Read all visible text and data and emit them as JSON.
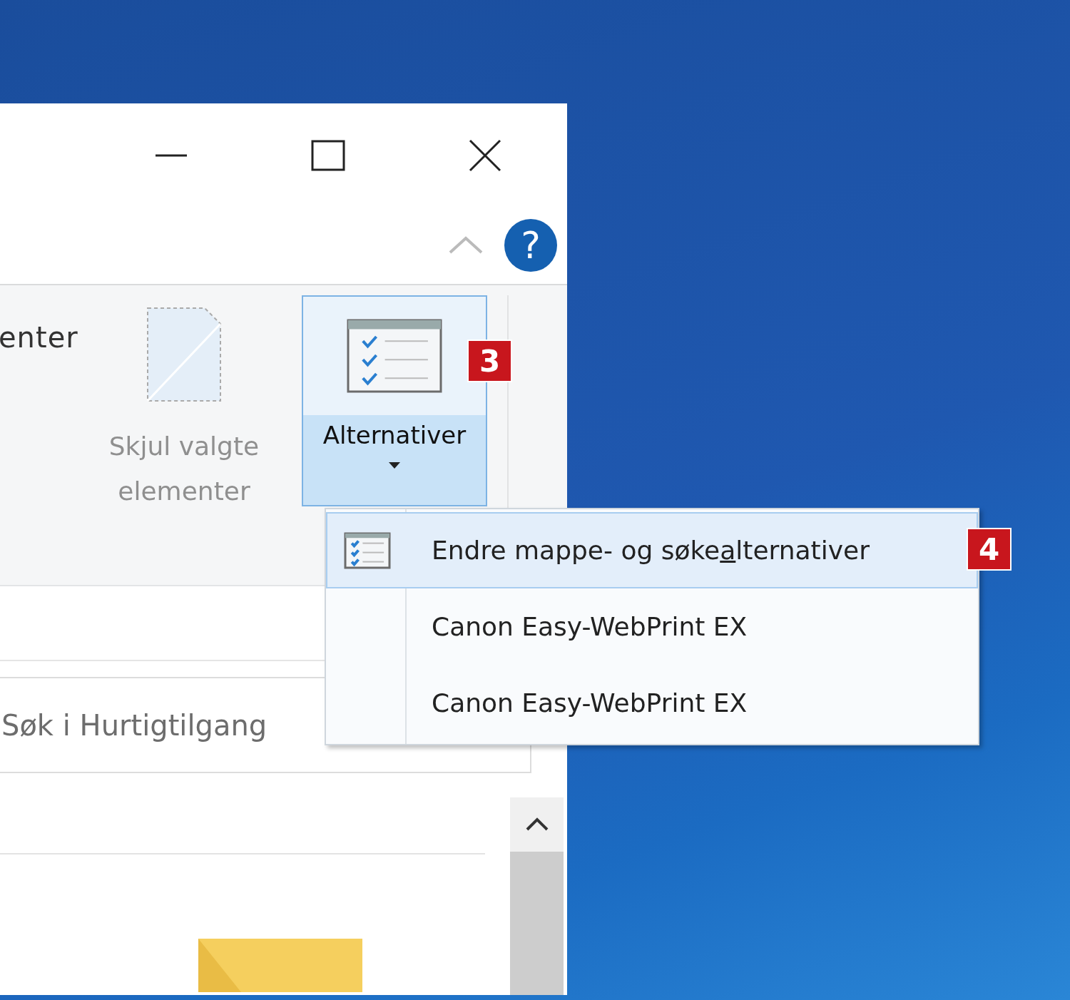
{
  "help_button": {
    "label": "?"
  },
  "ribbon": {
    "cut_label": "enter",
    "buttons": [
      {
        "kind": "command",
        "label": "Skjul valgte elementer",
        "disabled": true
      },
      {
        "kind": "dropdown",
        "label": "Alternativer",
        "expanded": true,
        "badge": "3"
      }
    ]
  },
  "search": {
    "placeholder": "Søk i Hurtigtilgang"
  },
  "menu": {
    "items": [
      {
        "kind": "with_icon",
        "label_before": "Endre mappe- og søke",
        "access_key": "a",
        "label_after": "lternativer",
        "selected": true,
        "badge": "4"
      },
      {
        "kind": "plain",
        "label": "Canon Easy-WebPrint EX",
        "selected": false
      },
      {
        "kind": "plain",
        "label": "Canon Easy-WebPrint EX",
        "selected": false
      }
    ]
  }
}
